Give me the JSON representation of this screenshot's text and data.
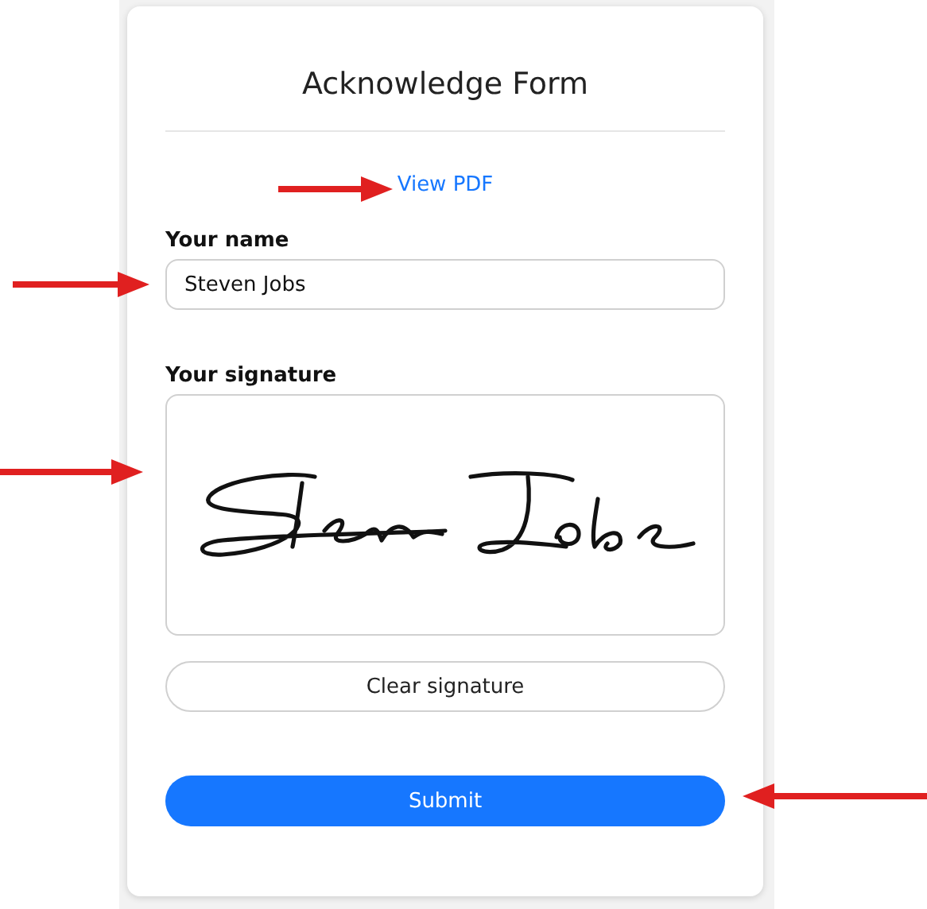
{
  "form": {
    "title": "Acknowledge Form",
    "link": "View PDF",
    "name_field": {
      "label": "Your name",
      "value": "Steven Jobs"
    },
    "signature_field": {
      "label": "Your signature"
    },
    "clear_button": "Clear signature",
    "submit_button": "Submit"
  }
}
